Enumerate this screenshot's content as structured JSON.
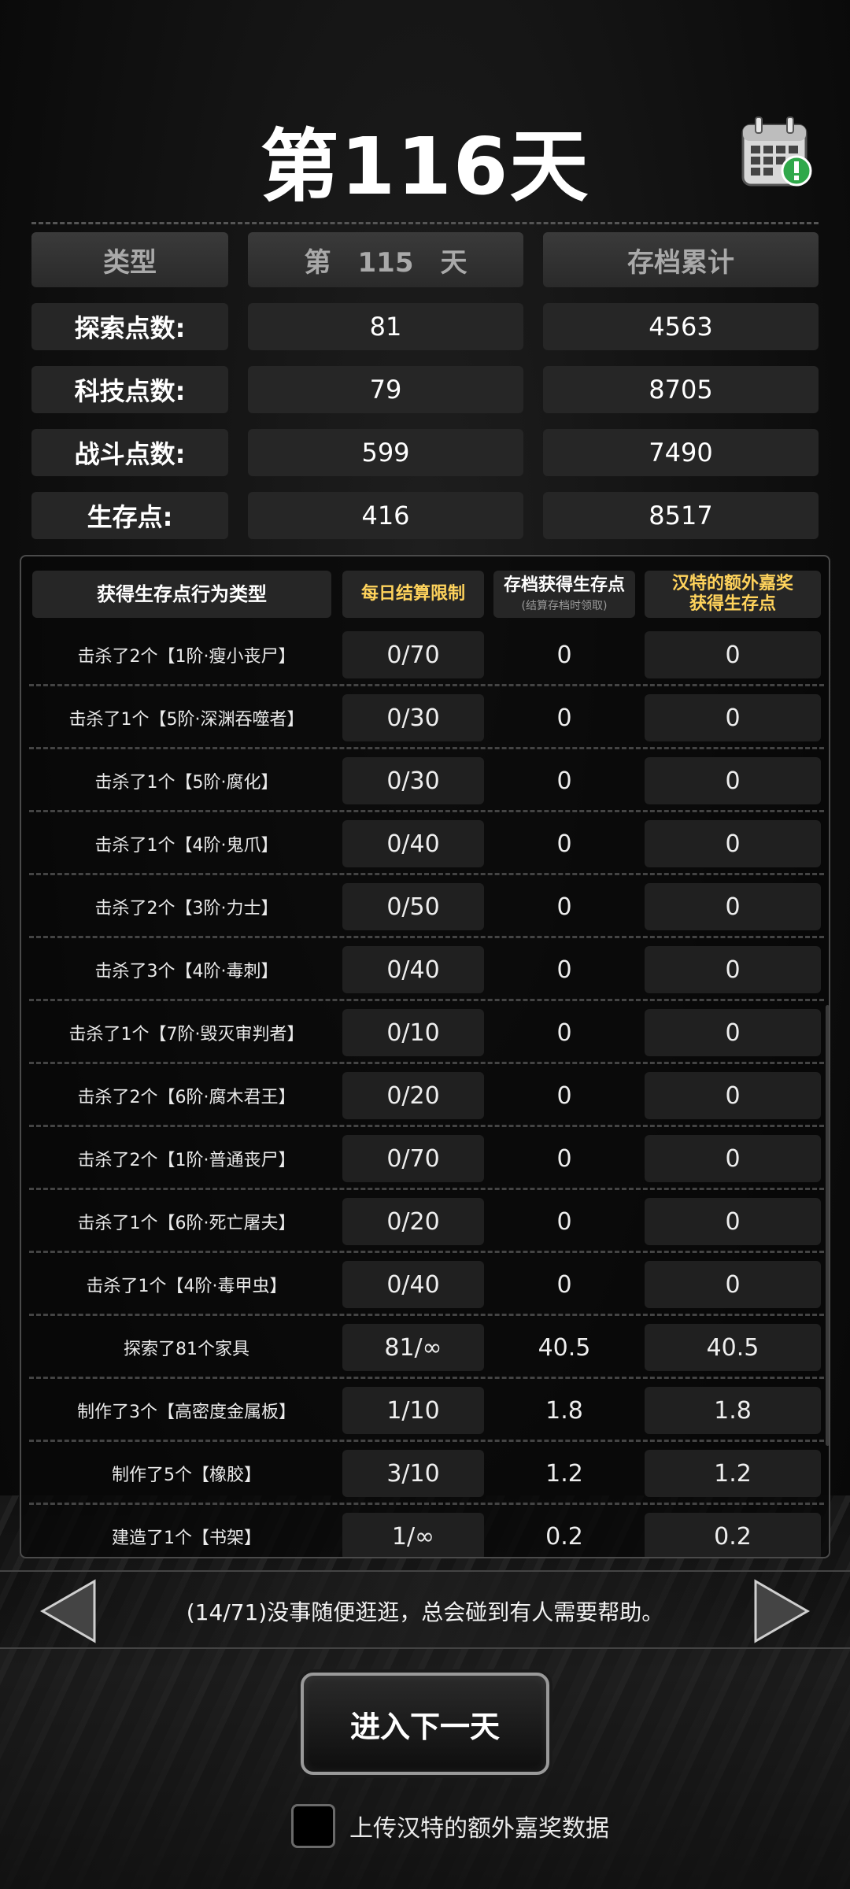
{
  "header": {
    "title": "第116天"
  },
  "icons": {
    "calendar": "calendar-alert-icon",
    "prev": "left-arrow-icon",
    "next": "right-arrow-icon"
  },
  "summary": {
    "headers": [
      "类型",
      "第　115　天",
      "存档累计"
    ],
    "rows": [
      {
        "label": "探索点数:",
        "day": "81",
        "total": "4563"
      },
      {
        "label": "科技点数:",
        "day": "79",
        "total": "8705"
      },
      {
        "label": "战斗点数:",
        "day": "599",
        "total": "7490"
      },
      {
        "label": "生存点:",
        "day": "416",
        "total": "8517"
      }
    ]
  },
  "table": {
    "headers": {
      "type": "获得生存点行为类型",
      "limit": "每日结算限制",
      "archive": "存档获得生存点",
      "archive_note": "(结算存档时领取)",
      "bonus_line1": "汉特的额外嘉奖",
      "bonus_line2": "获得生存点"
    },
    "rows": [
      {
        "name": "击杀了2个【1阶·瘦小丧尸】",
        "limit": "0/70",
        "archive": "0",
        "bonus": "0"
      },
      {
        "name": "击杀了1个【5阶·深渊吞噬者】",
        "limit": "0/30",
        "archive": "0",
        "bonus": "0"
      },
      {
        "name": "击杀了1个【5阶·腐化】",
        "limit": "0/30",
        "archive": "0",
        "bonus": "0"
      },
      {
        "name": "击杀了1个【4阶·鬼爪】",
        "limit": "0/40",
        "archive": "0",
        "bonus": "0"
      },
      {
        "name": "击杀了2个【3阶·力士】",
        "limit": "0/50",
        "archive": "0",
        "bonus": "0"
      },
      {
        "name": "击杀了3个【4阶·毒刺】",
        "limit": "0/40",
        "archive": "0",
        "bonus": "0"
      },
      {
        "name": "击杀了1个【7阶·毁灭审判者】",
        "limit": "0/10",
        "archive": "0",
        "bonus": "0"
      },
      {
        "name": "击杀了2个【6阶·腐木君王】",
        "limit": "0/20",
        "archive": "0",
        "bonus": "0"
      },
      {
        "name": "击杀了2个【1阶·普通丧尸】",
        "limit": "0/70",
        "archive": "0",
        "bonus": "0"
      },
      {
        "name": "击杀了1个【6阶·死亡屠夫】",
        "limit": "0/20",
        "archive": "0",
        "bonus": "0"
      },
      {
        "name": "击杀了1个【4阶·毒甲虫】",
        "limit": "0/40",
        "archive": "0",
        "bonus": "0"
      },
      {
        "name": "探索了81个家具",
        "limit": "81/∞",
        "archive": "40.5",
        "bonus": "40.5"
      },
      {
        "name": "制作了3个【高密度金属板】",
        "limit": "1/10",
        "archive": "1.8",
        "bonus": "1.8"
      },
      {
        "name": "制作了5个【橡胶】",
        "limit": "3/10",
        "archive": "1.2",
        "bonus": "1.2"
      },
      {
        "name": "建造了1个【书架】",
        "limit": "1/∞",
        "archive": "0.2",
        "bonus": "0.2"
      }
    ]
  },
  "message": {
    "text": "(14/71)没事随便逛逛，总会碰到有人需要帮助。"
  },
  "actions": {
    "next_day": "进入下一天",
    "upload_label": "上传汉特的额外嘉奖数据",
    "upload_checked": false
  },
  "colors": {
    "accent_gold": "#ffd35c",
    "background": "#0c0c0c",
    "cell": "#262626"
  }
}
